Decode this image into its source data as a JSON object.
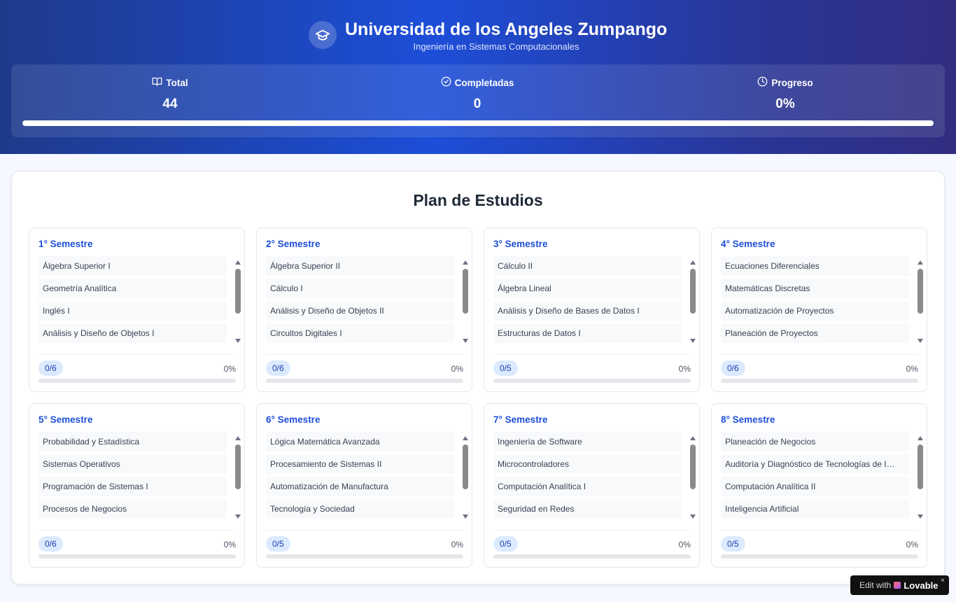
{
  "header": {
    "title": "Universidad de los Angeles Zumpango",
    "subtitle": "Ingeniería en Sistemas Computacionales",
    "logo_icon": "graduation-cap-icon"
  },
  "stats": {
    "total": {
      "label": "Total",
      "value": "44",
      "icon": "book-open-icon"
    },
    "completed": {
      "label": "Completadas",
      "value": "0",
      "icon": "check-circle-icon"
    },
    "progress": {
      "label": "Progreso",
      "value": "0%",
      "icon": "clock-icon"
    },
    "progress_fraction": 1.0
  },
  "plan": {
    "title": "Plan de Estudios",
    "semesters": [
      {
        "title": "1° Semestre",
        "courses": [
          "Álgebra Superior I",
          "Geometría Analítica",
          "Inglés I",
          "Análisis y Diseño de Objetos I"
        ],
        "badge": "0/6",
        "percent": "0%",
        "progress": 0
      },
      {
        "title": "2° Semestre",
        "courses": [
          "Álgebra Superior II",
          "Cálculo I",
          "Análisis y Diseño de Objetos II",
          "Circuitos Digitales I"
        ],
        "badge": "0/6",
        "percent": "0%",
        "progress": 0
      },
      {
        "title": "3° Semestre",
        "courses": [
          "Cálculo II",
          "Álgebra Lineal",
          "Análisis y Diseño de Bases de Datos I",
          "Estructuras de Datos I"
        ],
        "badge": "0/5",
        "percent": "0%",
        "progress": 0
      },
      {
        "title": "4° Semestre",
        "courses": [
          "Ecuaciones Diferenciales",
          "Matemáticas Discretas",
          "Automatización de Proyectos",
          "Planeación de Proyectos"
        ],
        "badge": "0/6",
        "percent": "0%",
        "progress": 0
      },
      {
        "title": "5° Semestre",
        "courses": [
          "Probabilidad y Estadística",
          "Sistemas Operativos",
          "Programación de Sistemas I",
          "Procesos de Negocios"
        ],
        "badge": "0/6",
        "percent": "0%",
        "progress": 0
      },
      {
        "title": "6° Semestre",
        "courses": [
          "Lógica Matemática Avanzada",
          "Procesamiento de Sistemas II",
          "Automatización de Manufactura",
          "Tecnología y Sociedad"
        ],
        "badge": "0/5",
        "percent": "0%",
        "progress": 0
      },
      {
        "title": "7° Semestre",
        "courses": [
          "Ingeniería de Software",
          "Microcontroladores",
          "Computación Analítica I",
          "Seguridad en Redes"
        ],
        "badge": "0/5",
        "percent": "0%",
        "progress": 0
      },
      {
        "title": "8° Semestre",
        "courses": [
          "Planeación de Negocios",
          "Auditoría y Diagnóstico de Tecnologías de Información",
          "Computación Analítica II",
          "Inteligencia Artificial"
        ],
        "badge": "0/5",
        "percent": "0%",
        "progress": 0
      }
    ]
  },
  "lovable": {
    "edit_label": "Edit with",
    "brand": "Lovable",
    "close": "×"
  },
  "colors": {
    "header_start": "#1e3a8a",
    "header_mid": "#1d4ed8",
    "header_end": "#312e81",
    "accent": "#1d4ed8",
    "badge_bg": "#dbeafe"
  }
}
